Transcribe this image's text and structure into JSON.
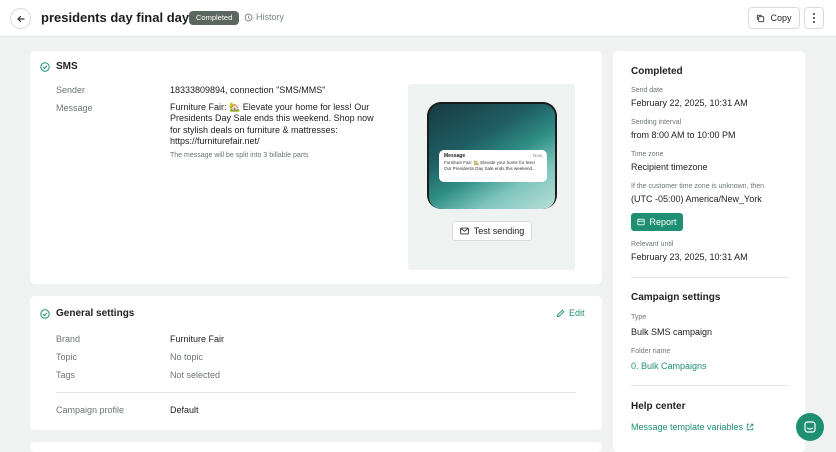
{
  "header": {
    "title": "presidents day final days",
    "status_badge": "Completed",
    "history_label": "History",
    "copy_label": "Copy"
  },
  "sms_card": {
    "title": "SMS",
    "sender_label": "Sender",
    "sender_value": "18333809894, connection \"SMS/MMS\"",
    "message_label": "Message",
    "message_value": "Furniture Fair: 🏡 Elevate your home for less! Our Presidents Day Sale ends this weekend. Shop now for stylish deals on furniture & mattresses: https://furniturefair.net/",
    "split_note": "The message will be split into 3 billable parts",
    "preview": {
      "notif_title": "Message",
      "notif_time": "Now",
      "notif_body": "Furniture Fair: 🏡 Elevate your home for less! Our Presidents Day Sale ends this weekend..."
    },
    "test_button": "Test sending"
  },
  "general_settings": {
    "title": "General settings",
    "edit_label": "Edit",
    "rows": [
      {
        "label": "Brand",
        "value": "Furniture Fair"
      },
      {
        "label": "Topic",
        "value": "No topic"
      },
      {
        "label": "Tags",
        "value": "Not selected"
      }
    ],
    "profile_label": "Campaign profile",
    "profile_value": "Default"
  },
  "sidebar": {
    "status_title": "Completed",
    "send_date_label": "Send date",
    "send_date_value": "February 22, 2025, 10:31 AM",
    "interval_label": "Sending interval",
    "interval_value": "from 8:00 AM to 10:00 PM",
    "timezone_label": "Time zone",
    "timezone_value": "Recipient timezone",
    "unknown_tz_label": "If the customer time zone is unknown, then",
    "unknown_tz_value": "(UTC -05:00) America/New_York",
    "report_button": "Report",
    "relevant_label": "Relevant until",
    "relevant_value": "February 23, 2025, 10:31 AM",
    "campaign_title": "Campaign settings",
    "type_label": "Type",
    "type_value": "Bulk SMS campaign",
    "folder_label": "Folder name",
    "folder_value": "0. Bulk Campaigns",
    "help_title": "Help center",
    "help_link": "Message template variables"
  },
  "colors": {
    "accent": "#1e8f73",
    "badge": "#5c6661",
    "background": "#f0f2f1"
  }
}
